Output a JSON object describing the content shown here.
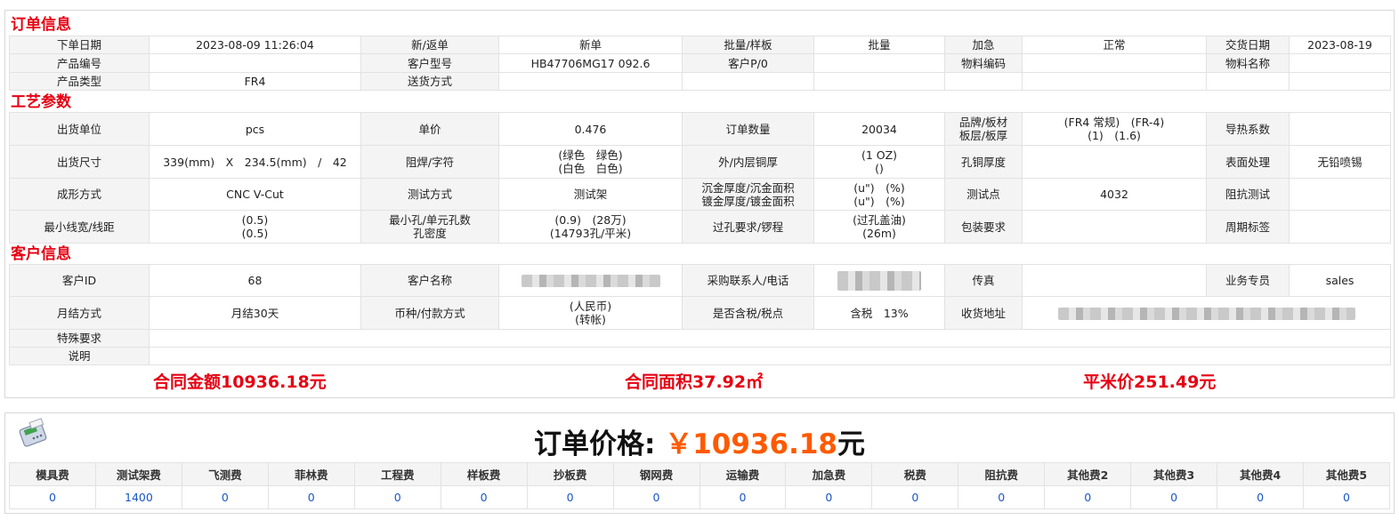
{
  "order_info": {
    "section_title": "订单信息",
    "row1": {
      "order_date_label": "下单日期",
      "order_date": "2023-08-09 11:26:04",
      "new_return_label": "新/返单",
      "new_return": "新单",
      "batch_sample_label": "批量/样板",
      "batch_sample": "批量",
      "urgent_label": "加急",
      "urgent": "正常",
      "delivery_date_label": "交货日期",
      "delivery_date": "2023-08-19"
    },
    "row2": {
      "product_no_label": "产品编号",
      "product_no": "",
      "customer_model_label": "客户型号",
      "customer_model": "HB47706MG17 092.6",
      "customer_po_label": "客户P/0",
      "customer_po": "",
      "material_code_label": "物料编码",
      "material_code": "",
      "material_name_label": "物料名称",
      "material_name": ""
    },
    "row3": {
      "product_type_label": "产品类型",
      "product_type": "FR4",
      "shipping_method_label": "送货方式",
      "shipping_method": ""
    }
  },
  "process": {
    "section_title": "工艺参数",
    "ship_unit_label": "出货单位",
    "ship_unit": "pcs",
    "unit_price_label": "单价",
    "unit_price": "0.476",
    "order_qty_label": "订单数量",
    "order_qty": "20034",
    "brand_label_1": "品牌/板材",
    "brand_label_2": "板层/板厚",
    "brand_line1": "(FR4 常规)　(FR-4)",
    "brand_line2": "(1)　(1.6)",
    "thermal_label": "导热系数",
    "thermal": "",
    "ship_size_label": "出货尺寸",
    "ship_size": "339(mm)　X　234.5(mm)　/　42",
    "solder_label": "阻焊/字符",
    "solder_line1": "(绿色　绿色)",
    "solder_line2": "(白色　白色)",
    "copper_label": "外/内层铜厚",
    "copper_line1": "(1 OZ)",
    "copper_line2": "()",
    "hole_copper_label": "孔铜厚度",
    "hole_copper": "",
    "surface_label": "表面处理",
    "surface": "无铅喷锡",
    "forming_label": "成形方式",
    "forming": "CNC V-Cut",
    "test_label": "测试方式",
    "test": "测试架",
    "gold_label_1": "沉金厚度/沉金面积",
    "gold_label_2": "镀金厚度/镀金面积",
    "gold_line1": "(u\")　(%)",
    "gold_line2": "(u\")　(%)",
    "test_points_label": "测试点",
    "test_points": "4032",
    "impedance_label": "阻抗测试",
    "impedance": "",
    "min_width_label": "最小线宽/线距",
    "min_width_line1": "(0.5)",
    "min_width_line2": "(0.5)",
    "min_hole_label_1": "最小孔/单元孔数",
    "min_hole_label_2": "孔密度",
    "min_hole_line1": "(0.9)　(28万)",
    "min_hole_line2": "(14793孔/平米)",
    "via_label": "过孔要求/锣程",
    "via_line1": "(过孔盖油)",
    "via_line2": "(26m)",
    "packing_label": "包装要求",
    "packing": "",
    "cycle_label": "周期标签",
    "cycle": ""
  },
  "customer": {
    "section_title": "客户信息",
    "id_label": "客户ID",
    "id": "68",
    "name_label": "客户名称",
    "contact_label": "采购联系人/电话",
    "fax_label": "传真",
    "fax": "",
    "sales_label": "业务专员",
    "sales": "sales",
    "settle_label": "月结方式",
    "settle": "月结30天",
    "currency_label": "币种/付款方式",
    "currency_line1": "(人民币)",
    "currency_line2": "(转帐)",
    "tax_label": "是否含税/税点",
    "tax": "含税　13%",
    "address_label": "收货地址",
    "special_label": "特殊要求",
    "special": "",
    "note_label": "说明",
    "note": ""
  },
  "summary": {
    "contract_amount": "合同金额10936.18元",
    "contract_area": "合同面积37.92㎡",
    "sqm_price": "平米价251.49元"
  },
  "price": {
    "label": "订单价格: ",
    "amount": "￥10936.18",
    "unit": "元"
  },
  "fees": {
    "headers": [
      "模具费",
      "测试架费",
      "飞测费",
      "菲林费",
      "工程费",
      "样板费",
      "抄板费",
      "钢网费",
      "运输费",
      "加急费",
      "税费",
      "阻抗费",
      "其他费2",
      "其他费3",
      "其他费4",
      "其他费5"
    ],
    "values": [
      "0",
      "1400",
      "0",
      "0",
      "0",
      "0",
      "0",
      "0",
      "0",
      "0",
      "0",
      "0",
      "0",
      "0",
      "0",
      "0"
    ]
  }
}
